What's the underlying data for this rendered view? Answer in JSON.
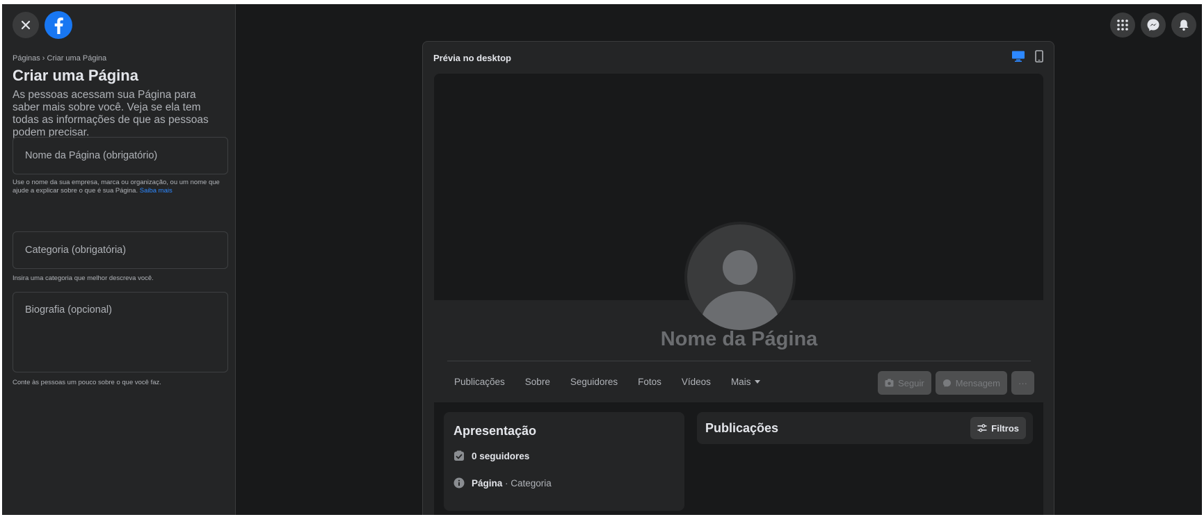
{
  "sidebar": {
    "breadcrumb": "Páginas › Criar uma Página",
    "title": "Criar uma Página",
    "description": "As pessoas acessam sua Página para saber mais sobre você. Veja se ela tem todas as informações de que as pessoas podem precisar.",
    "name_field": {
      "placeholder": "Nome da Página (obrigatório)",
      "helper": "Use o nome da sua empresa, marca ou organização, ou um nome que ajude a explicar sobre o que é sua Página.",
      "helper_link": "Saiba mais"
    },
    "category_field": {
      "placeholder": "Categoria (obrigatória)",
      "helper": "Insira uma categoria que melhor descreva você."
    },
    "bio_field": {
      "placeholder": "Biografia (opcional)",
      "helper": "Conte às pessoas um pouco sobre o que você faz."
    }
  },
  "icons": {
    "close": "close-icon",
    "logo": "facebook-logo-icon",
    "menu": "grid-menu-icon",
    "messenger": "messenger-icon",
    "notifications": "bell-icon",
    "desktop": "desktop-icon",
    "mobile": "mobile-icon"
  },
  "preview": {
    "header": "Prévia no desktop",
    "page_name": "Nome da Página",
    "tabs": [
      "Publicações",
      "Sobre",
      "Seguidores",
      "Fotos",
      "Vídeos",
      "Mais"
    ],
    "actions": {
      "follow": "Seguir",
      "message": "Mensagem",
      "more": "···"
    },
    "intro": {
      "title": "Apresentação",
      "followers": "0 seguidores",
      "page_label": "Página",
      "category": " · Categoria"
    },
    "posts": {
      "title": "Publicações",
      "filter": "Filtros"
    }
  },
  "colors": {
    "background": "#18191a",
    "surface": "#242526",
    "brand": "#1877f2",
    "link": "#2d88ff"
  }
}
